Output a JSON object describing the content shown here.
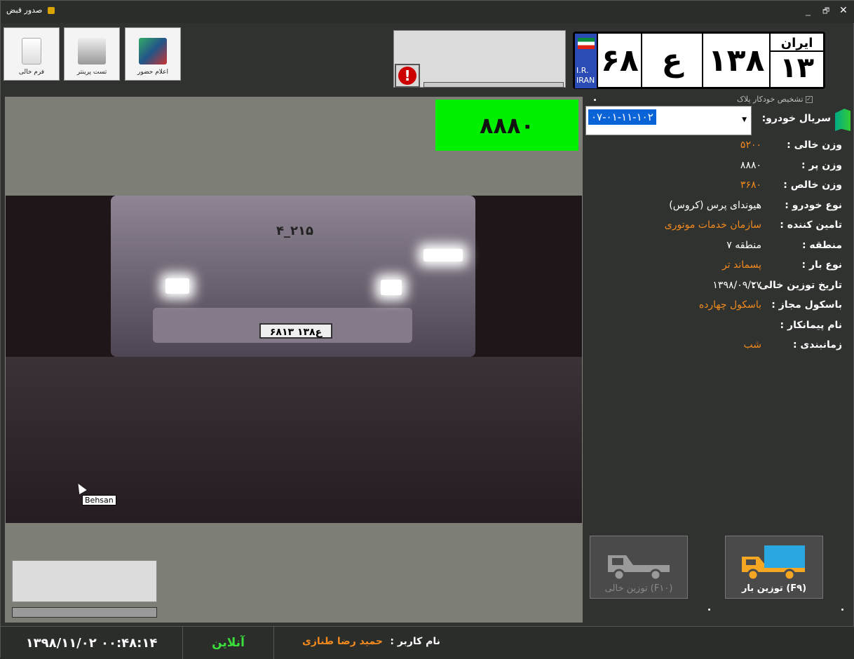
{
  "window": {
    "title": "صدور قبض",
    "controls": [
      "_",
      "🗗",
      "✕"
    ]
  },
  "toolbar": [
    {
      "label": "فرم خالی",
      "icon": "blank-form-icon"
    },
    {
      "label": "تست پرینتر",
      "icon": "printer-icon"
    },
    {
      "label": "اعلام حضور",
      "icon": "attendance-icon"
    }
  ],
  "plate": {
    "flag_text": "I.R. IRAN",
    "part1": "۶۸",
    "letter": "ع",
    "part2": "۱۳۸",
    "region_label": "ایران",
    "region_code": "۱۳"
  },
  "detect_label": "تشخیص خودکار پلاک",
  "weight_display": "۸۸۸۰",
  "camera_overlay": {
    "label": "Behsan",
    "plate_text": "۶۸ع۱۳۸ ۱۳",
    "truck_code": "۴_۲۱۵"
  },
  "serial": {
    "label": "سریال خودرو:",
    "value": "۰۷-۰۱-۱۱-۱۰۲"
  },
  "details": [
    {
      "key": "وزن خالی :",
      "value": "۵۲۰۰",
      "orange": true
    },
    {
      "key": "وزن پر :",
      "value": "۸۸۸۰",
      "orange": false
    },
    {
      "key": "وزن خالص :",
      "value": "۳۶۸۰",
      "orange": true
    },
    {
      "key": "نوع خودرو :",
      "value": "هیوندای پرس (کروس)",
      "orange": false
    },
    {
      "key": "تامین کننده :",
      "value": "سازمان خدمات موتوری",
      "orange": true
    },
    {
      "key": "منطقه :",
      "value": "منطقه ۷",
      "orange": false
    },
    {
      "key": "نوع بار :",
      "value": "پسماند تر",
      "orange": true
    },
    {
      "key": "تاریخ توزین خالی :",
      "value": "۱۳۹۸/۰۹/۲۷",
      "orange": false
    },
    {
      "key": "باسکول مجاز :",
      "value": "باسکول چهارده",
      "orange": true
    },
    {
      "key": "نام پیمانکار :",
      "value": "",
      "orange": false
    },
    {
      "key": "زمانبندی :",
      "value": "شب",
      "orange": true
    }
  ],
  "buttons": {
    "empty_weigh": "توزین خالی (F۱۰)",
    "load_weigh": "توزین بار (F۹)"
  },
  "status": {
    "datetime": "۱۳۹۸/۱۱/۰۲  ۰۰:۴۸:۱۴",
    "online": "آنلاین",
    "user_label": "نام کاربر :",
    "user_name": "حمید رضا طنازی"
  },
  "colors": {
    "accent_orange": "#f28a1e",
    "weight_bg": "#00f000",
    "online": "#3adf3a"
  }
}
